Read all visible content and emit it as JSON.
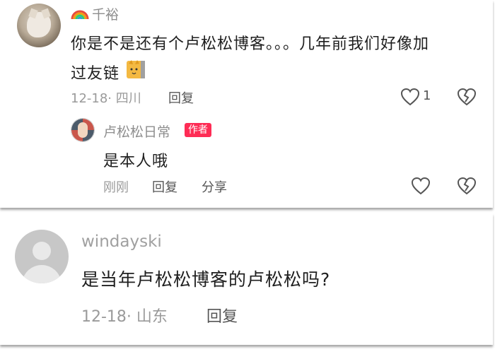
{
  "comments": [
    {
      "name": "千裕",
      "text_line1": "你是不是还有个卢松松博客。。。几年前我们好像加",
      "text_line2": "过友链",
      "date_location": "12-18· 四川",
      "reply_label": "回复",
      "like_count": "1",
      "reply": {
        "name": "卢松松日常",
        "badge": "作者",
        "text": "是本人哦",
        "time": "刚刚",
        "reply_label": "回复",
        "share_label": "分享"
      }
    },
    {
      "name": "windayski",
      "text": "是当年卢松松博客的卢松松吗?",
      "date_location": "12-18· 山东",
      "reply_label": "回复"
    }
  ],
  "icons": {
    "like": "heart-outline-icon",
    "dislike": "broken-heart-icon",
    "name_emoji": "rainbow-emoji",
    "text_emoji": "cat-emoji"
  },
  "colors": {
    "author_badge": "#fe2c55",
    "meta_text": "#9a9a9a",
    "body_text": "#1f1f1f"
  }
}
